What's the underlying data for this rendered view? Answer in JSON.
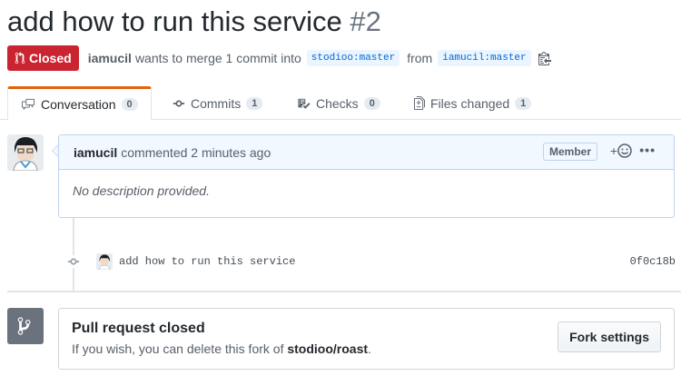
{
  "pr": {
    "title": "add how to run this service",
    "number": "#2",
    "state": "Closed",
    "author": "iamucil",
    "summary_text": "wants to merge 1 commit into",
    "base_branch": "stodioo:master",
    "from_text": "from",
    "head_branch": "iamucil:master"
  },
  "tabs": [
    {
      "label": "Conversation",
      "count": "0"
    },
    {
      "label": "Commits",
      "count": "1"
    },
    {
      "label": "Checks",
      "count": "0"
    },
    {
      "label": "Files changed",
      "count": "1"
    }
  ],
  "comment": {
    "author": "iamucil",
    "time_text": "commented 2 minutes ago",
    "role": "Member",
    "reaction_plus": "+",
    "menu": "•••",
    "body": "No description provided."
  },
  "commit": {
    "message": "add how to run this service",
    "sha": "0f0c18b"
  },
  "closed": {
    "heading": "Pull request closed",
    "prefix": "If you wish, you can delete this fork of",
    "repo": "stodioo/roast",
    "suffix": ".",
    "button": "Fork settings"
  },
  "colors": {
    "closed": "#cb2431",
    "active_tab": "#e36209",
    "link": "#0366d6"
  }
}
